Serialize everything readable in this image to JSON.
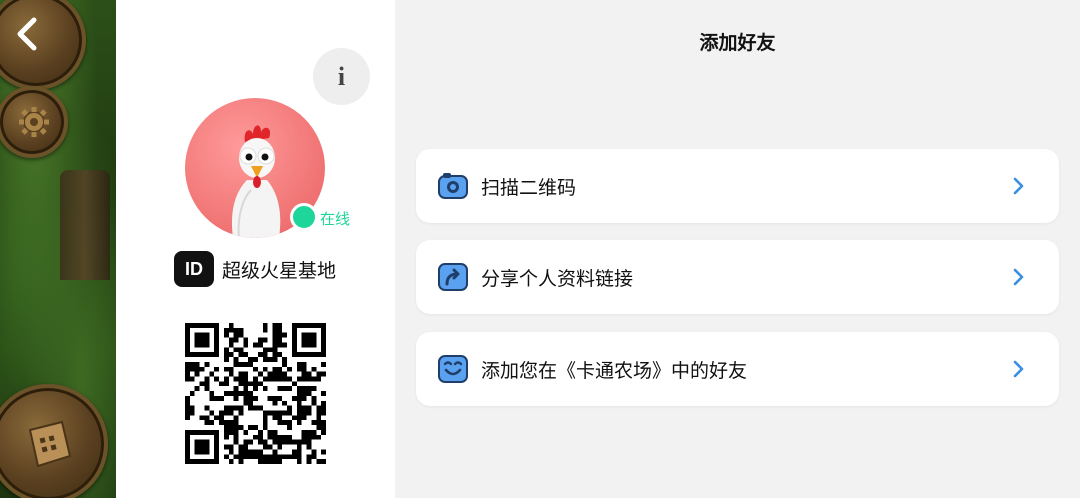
{
  "game": {
    "back_icon": "chevron-left-icon",
    "gear_icon": "gear-icon",
    "shop_icon": "cash-register-icon"
  },
  "profile": {
    "info_label": "i",
    "status": "在线",
    "id_badge": "ID",
    "name": "超级火星基地",
    "avatar_icon": "chicken-avatar",
    "status_color": "#1fd69a"
  },
  "main": {
    "title": "添加好友",
    "options": [
      {
        "label": "扫描二维码",
        "icon": "camera-icon"
      },
      {
        "label": "分享个人资料链接",
        "icon": "share-icon"
      },
      {
        "label": "添加您在《卡通农场》中的好友",
        "icon": "smile-icon"
      }
    ],
    "accent_color": "#3b8fe0"
  }
}
